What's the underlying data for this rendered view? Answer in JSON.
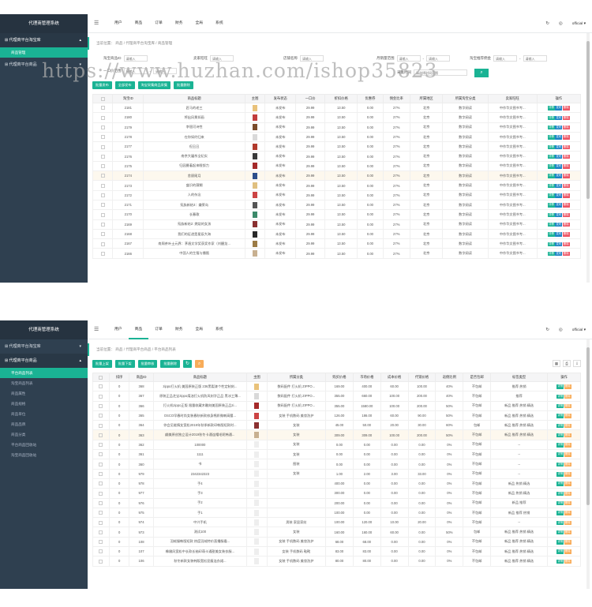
{
  "watermark": "https://www.huzhan.com/ishop35823",
  "s1": {
    "brand": "代理商管理系统",
    "nav": [
      {
        "label": "代理商平台淘宝库",
        "active": true,
        "subs": [
          {
            "label": "商品管理",
            "active": true
          }
        ]
      },
      {
        "label": "代理商平台商品",
        "active": false,
        "subs": []
      }
    ],
    "topnav": [
      "用户",
      "商品",
      "订单",
      "财务",
      "全局",
      "系统"
    ],
    "user": "official ▾",
    "breadcrumb": "当前位置： 商品 / 代理商平台淘宝库 / 商品管理",
    "filters": [
      {
        "label": "淘宝商品ID",
        "placeholder": "请输入"
      },
      {
        "label": "卖家旺旺",
        "placeholder": "请输入"
      },
      {
        "label": "店铺名称",
        "placeholder": "请输入"
      },
      {
        "label": "月销量范围",
        "placeholder": "请输入",
        "placeholder2": "请输入"
      },
      {
        "label": "淘宝推荐佣金",
        "placeholder": "请输入",
        "placeholder2": "请输入"
      },
      {
        "label": "一口价范围",
        "placeholder": "请输入",
        "placeholder2": "请输入"
      },
      {
        "label": "采集时间",
        "placeholder": "请选择时间范围"
      }
    ],
    "actions": [
      "批量发布",
      "全部发布",
      "淘宝采集商品采集",
      "批量删除"
    ],
    "columns": [
      "",
      "淘宝ID",
      "商品标题",
      "主图",
      "发布状态",
      "一口价",
      "折扣价格",
      "优惠券",
      "佣金比率",
      "所属地区",
      "所属淘宝分类",
      "卖家旺旺",
      "操作"
    ],
    "rows": [
      [
        "2181",
        "匠马的老三",
        "未发布",
        "29.99",
        "13.50",
        "0.00",
        "27%",
        "北京",
        "数字阅读",
        "中作华文图书专..."
      ],
      [
        "2180",
        "将出风景如画",
        "未发布",
        "29.99",
        "13.50",
        "0.00",
        "27%",
        "北京",
        "数字阅读",
        "中作华文图书专..."
      ],
      [
        "2179",
        "李银河诗性",
        "未发布",
        "29.99",
        "13.50",
        "0.00",
        "27%",
        "北京",
        "数字阅读",
        "中作华文图书专..."
      ],
      [
        "2178",
        "在你如约归来",
        "未发布",
        "29.99",
        "13.50",
        "0.00",
        "27%",
        "北京",
        "数字阅读",
        "中作华文图书专..."
      ],
      [
        "2177",
        "但丑丑",
        "未发布",
        "29.99",
        "13.50",
        "0.00",
        "27%",
        "北京",
        "数字阅读",
        "中作华文图书专..."
      ],
      [
        "2176",
        "南京大屠杀全纪实",
        "未发布",
        "29.99",
        "13.50",
        "0.00",
        "27%",
        "北京",
        "数字阅读",
        "中作华文图书专..."
      ],
      [
        "2175",
        "归园曼着起来眼努力",
        "未发布",
        "29.99",
        "13.50",
        "0.00",
        "27%",
        "北京",
        "数字阅读",
        "中作华文图书专..."
      ],
      [
        "2174",
        "舍顾尾月",
        "未发布",
        "29.99",
        "13.50",
        "0.00",
        "27%",
        "北京",
        "数字阅读",
        "中作华文图书专..."
      ],
      [
        "2173",
        "盛识的薇糊",
        "未发布",
        "29.99",
        "13.50",
        "0.00",
        "27%",
        "北京",
        "数字阅读",
        "中作华文图书专..."
      ],
      [
        "2172",
        "人的杂念",
        "未发布",
        "29.99",
        "13.50",
        "0.00",
        "27%",
        "北京",
        "数字阅读",
        "中作华文图书专..."
      ],
      [
        "2171",
        "氖族新结3：嫌莱岛",
        "未发布",
        "29.99",
        "13.50",
        "0.00",
        "27%",
        "北京",
        "数字阅读",
        "中作华文图书专..."
      ],
      [
        "2170",
        "长春歌",
        "未发布",
        "29.99",
        "13.50",
        "0.00",
        "27%",
        "北京",
        "数字阅读",
        "中作华文图书专..."
      ],
      [
        "2169",
        "氖族新结2: 燃烧的女孩",
        "未发布",
        "29.99",
        "13.50",
        "0.00",
        "27%",
        "北京",
        "数字阅读",
        "中作华文图书专..."
      ],
      [
        "2168",
        "我们的征途是星辰大海",
        "未发布",
        "29.99",
        "13.50",
        "0.00",
        "27%",
        "北京",
        "数字阅读",
        "中作华文图书专..."
      ],
      [
        "2167",
        "南周茶叶土元界：茅盾文学奖获奖作家（刘醒龙...",
        "未发布",
        "29.99",
        "13.50",
        "0.00",
        "27%",
        "北京",
        "数字阅读",
        "中作华文图书专..."
      ],
      [
        "2166",
        "中国人的生殖与播殖",
        "未发布",
        "29.99",
        "13.50",
        "0.00",
        "27%",
        "北京",
        "数字阅读",
        "中作华文图书专..."
      ]
    ],
    "row_buttons": [
      "详情",
      "发布",
      "删除"
    ]
  },
  "s2": {
    "brand": "代理商管理系统",
    "nav": [
      {
        "label": "代理商平台淘宝库",
        "active": false,
        "subs": []
      },
      {
        "label": "代理商平台商品",
        "active": true,
        "subs": [
          {
            "label": "平台商品列表",
            "active": true
          },
          {
            "label": "淘宝商品列表",
            "active": false
          },
          {
            "label": "商品属性",
            "active": false
          },
          {
            "label": "商品规格",
            "active": false
          },
          {
            "label": "商品单位",
            "active": false
          },
          {
            "label": "商品品牌",
            "active": false
          },
          {
            "label": "商品分类",
            "active": false
          },
          {
            "label": "平台商品回收站",
            "active": false
          },
          {
            "label": "淘宝商品回收站",
            "active": false
          }
        ]
      }
    ],
    "topnav": [
      "用户",
      "商品",
      "订单",
      "财务",
      "全局",
      "系统"
    ],
    "user": "official ▾",
    "breadcrumb": "当前位置： 商品 / 代理商平台商品 / 平台商品列表",
    "actions": [
      "批量上架",
      "批量下架",
      "批量审核",
      "批量删除"
    ],
    "columns": [
      "",
      "排序",
      "商品ID",
      "商品标题",
      "主图",
      "所属分类",
      "购买价格",
      "市场价格",
      "成本价格",
      "代销价格",
      "返佣比例",
      "是否包邮",
      "标签类型",
      "操作"
    ],
    "rows": [
      [
        "0",
        "368",
        "zippo打火机 美国原装正版 236黑裂漆个性定制刻...",
        "数码配件 打火机 ZIPPO...",
        "169.00",
        "400.00",
        "60.00",
        "100.00",
        "40%",
        "不包邮",
        "推荐 热销"
      ],
      [
        "0",
        "367",
        "原装正品芝宝zippo煤油打火机防风刻字正品 黑冰工薄...",
        "数码配件 打火机 ZIPPO...",
        "355.00",
        "660.00",
        "100.00",
        "200.00",
        "40%",
        "不包邮",
        "推荐"
      ],
      [
        "0",
        "366",
        "打火机zippo正版 限量收藏木雕刻美国原装正品zi...",
        "数码配件 打火机 ZIPPO...",
        "355.00",
        "1580.00",
        "100.00",
        "200.00",
        "50%",
        "不包邮",
        "新品 推荐 热销 精选"
      ],
      [
        "0",
        "365",
        "OSCO早春时尚女装春秋新款修身棉质微喇高腰...",
        "女装 手机数码 美妆洗护",
        "126.00",
        "186.00",
        "60.00",
        "90.00",
        "50%",
        "不包邮",
        "新品 推荐 热销 精选"
      ],
      [
        "0",
        "364",
        "你会见能情女宽松2019年秋季新款印韩版短款时...",
        "女装",
        "45.00",
        "50.00",
        "20.00",
        "30.00",
        "60%",
        "包邮",
        "新品 推荐 热销 精选"
      ],
      [
        "0",
        "363",
        "翩美原创独立设计2019秋冬卡通连帽毛呢韩通...",
        "女装",
        "309.00",
        "309.00",
        "100.00",
        "200.00",
        "50%",
        "不包邮",
        "新品 推荐 热销 精选"
      ],
      [
        "0",
        "362",
        "100000",
        "女装",
        "0.00",
        "0.00",
        "0.00",
        "0.00",
        "0%",
        "不包邮",
        "--"
      ],
      [
        "0",
        "361",
        "1111",
        "女装",
        "0.00",
        "0.00",
        "0.00",
        "0.00",
        "0%",
        "不包邮",
        "--"
      ],
      [
        "0",
        "360",
        "书",
        "图装",
        "0.00",
        "0.00",
        "0.00",
        "0.00",
        "0%",
        "不包邮",
        "--"
      ],
      [
        "0",
        "979",
        "2342342323",
        "女装",
        "1.00",
        "2.00",
        "3.00",
        "33.00",
        "0%",
        "不包邮",
        "--"
      ],
      [
        "0",
        "978",
        "手4",
        "",
        "400.00",
        "0.00",
        "0.00",
        "0.00",
        "0%",
        "不包邮",
        "新品 热销 精选"
      ],
      [
        "0",
        "977",
        "手3",
        "",
        "300.00",
        "0.00",
        "0.00",
        "0.00",
        "0%",
        "不包邮",
        "新品 热销 精选"
      ],
      [
        "0",
        "976",
        "手2",
        "",
        "200.00",
        "0.00",
        "0.00",
        "0.00",
        "0%",
        "不包邮",
        "新品 推荐"
      ],
      [
        "0",
        "975",
        "手1",
        "",
        "100.00",
        "0.00",
        "0.00",
        "0.00",
        "0%",
        "不包邮",
        "新品 推荐 热销"
      ],
      [
        "0",
        "974",
        "中兴手机",
        "男装 家居家纺",
        "100.00",
        "120.00",
        "10.00",
        "20.00",
        "0%",
        "不包邮",
        "--"
      ],
      [
        "0",
        "973",
        "测试100",
        "女装",
        "160.00",
        "160.00",
        "60.00",
        "0.00",
        "50%",
        "包邮",
        "新品 推荐 热销 精选"
      ],
      [
        "0",
        "108",
        "羽绒服韩版短款 热度羽绒特价直播服看...",
        "女装 手机数码 美妆洗护",
        "68.00",
        "68.00",
        "0.00",
        "0.00",
        "0%",
        "不包邮",
        "新品 推荐 热销 精选"
      ],
      [
        "0",
        "107",
        "橡嫩风宽松中长款长袖印萌卡通甜美女装衣服...",
        "女装 手机数码 鞋靴",
        "83.00",
        "83.00",
        "0.00",
        "0.00",
        "0%",
        "不包邮",
        "新品 推荐 热销 精选"
      ],
      [
        "0",
        "106",
        "秋冬新款女装韩版宽松显瘦连衣裙...",
        "女装 手机数码 美妆洗护",
        "80.00",
        "80.00",
        "0.00",
        "0.00",
        "0%",
        "不包邮",
        "新品 推荐 热销 精选"
      ]
    ],
    "row_buttons": [
      "详情",
      "删除"
    ]
  },
  "colors": {
    "accent": "#1ab394",
    "sidebar": "#2f4050",
    "danger": "#ed5565",
    "warn": "#f8ac59",
    "info": "#1c84c6"
  }
}
